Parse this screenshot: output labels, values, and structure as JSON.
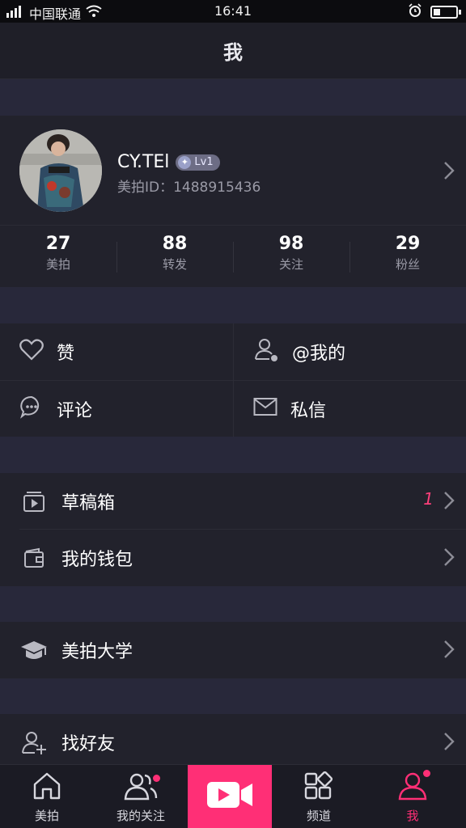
{
  "status_bar": {
    "carrier": "中国联通",
    "time": "16:41",
    "battery_level": 0.3,
    "icons": [
      "signal-icon",
      "wifi-icon",
      "alarm-icon",
      "battery-icon"
    ]
  },
  "header": {
    "title": "我"
  },
  "profile": {
    "username": "CY.TEl",
    "level_badge": "Lv1",
    "meipai_id": "美拍ID：1488915436",
    "stats": [
      {
        "value": "27",
        "label": "美拍"
      },
      {
        "value": "88",
        "label": "转发"
      },
      {
        "value": "98",
        "label": "关注"
      },
      {
        "value": "29",
        "label": "粉丝"
      }
    ]
  },
  "quick_grid": [
    {
      "label": "赞",
      "icon": "heart-icon"
    },
    {
      "label": "@我的",
      "icon": "person-at-icon"
    },
    {
      "label": "评论",
      "icon": "comment-icon"
    },
    {
      "label": "私信",
      "icon": "mail-icon"
    }
  ],
  "menu": {
    "drafts": {
      "label": "草稿箱",
      "count": "1",
      "icon": "drafts-icon"
    },
    "wallet": {
      "label": "我的钱包",
      "icon": "wallet-icon"
    },
    "university": {
      "label": "美拍大学",
      "icon": "graduation-cap-icon"
    },
    "find_friends": {
      "label": "找好友",
      "icon": "add-friend-icon"
    }
  },
  "tab_bar": {
    "items": [
      {
        "label": "美拍",
        "icon": "home-icon"
      },
      {
        "label": "我的关注",
        "icon": "following-icon",
        "badge_dot": true
      },
      {
        "label": "",
        "icon": "video-camera-icon"
      },
      {
        "label": "频道",
        "icon": "channels-icon"
      },
      {
        "label": "我",
        "icon": "profile-icon",
        "active": true,
        "badge_dot": true
      }
    ]
  },
  "colors": {
    "accent": "#ff2f76",
    "background": "#1a1a22",
    "panel": "#22222c",
    "separator": "#28283a"
  }
}
